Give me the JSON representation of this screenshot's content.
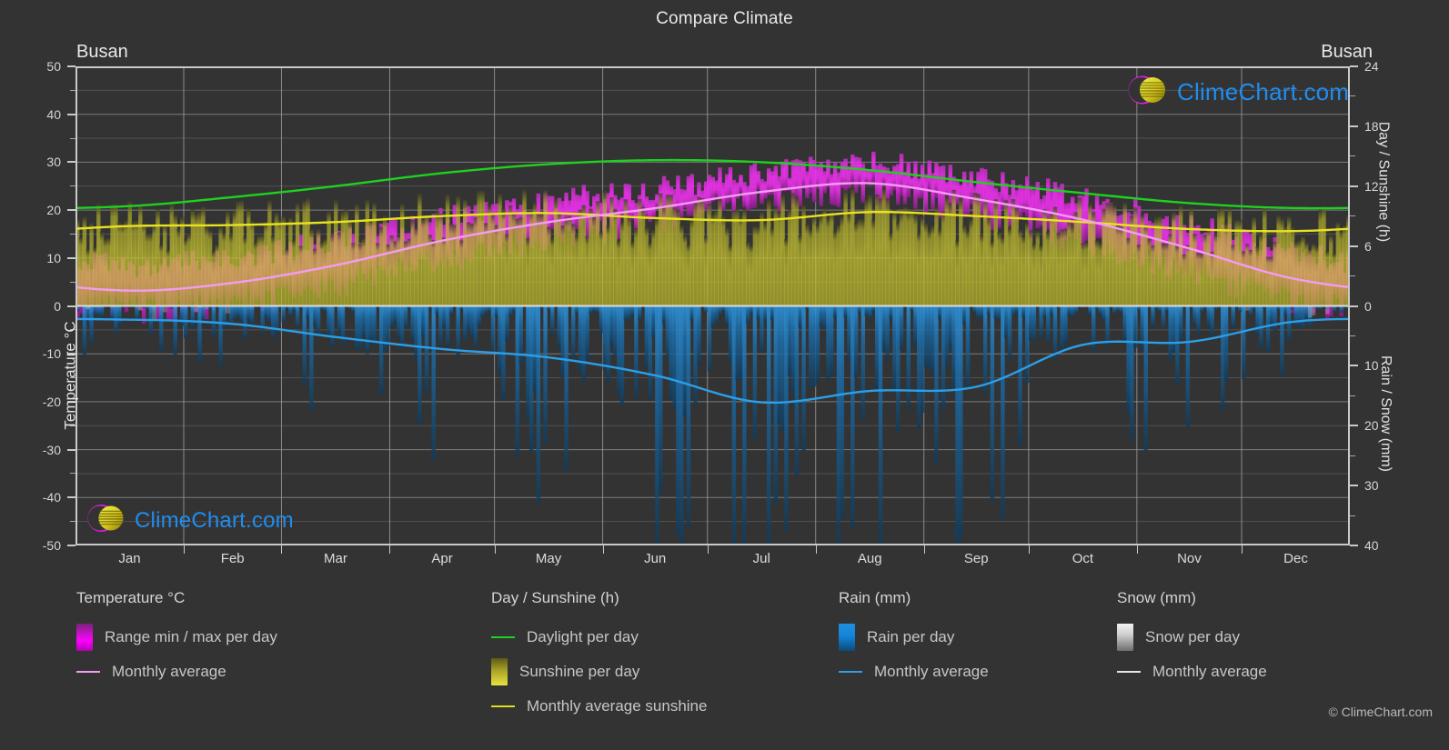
{
  "header": {
    "title": "Compare Climate",
    "city_left": "Busan",
    "city_right": "Busan"
  },
  "axes": {
    "left_title": "Temperature °C",
    "left_ticks": [
      "50",
      "40",
      "30",
      "20",
      "10",
      "0",
      "-10",
      "-20",
      "-30",
      "-40",
      "-50"
    ],
    "right_top_title": "Day / Sunshine (h)",
    "right_top_ticks": [
      "24",
      "18",
      "12",
      "6",
      "0"
    ],
    "right_bottom_title": "Rain / Snow (mm)",
    "right_bottom_ticks": [
      "0",
      "10",
      "20",
      "30",
      "40"
    ],
    "x_ticks": [
      "Jan",
      "Feb",
      "Mar",
      "Apr",
      "May",
      "Jun",
      "Jul",
      "Aug",
      "Sep",
      "Oct",
      "Nov",
      "Dec"
    ]
  },
  "legend": {
    "groups": [
      {
        "heading": "Temperature °C",
        "items": [
          {
            "label": "Range min / max per day",
            "marker": "box",
            "style": "sw-temp"
          },
          {
            "label": "Monthly average",
            "marker": "line",
            "color": "#f49cf4"
          }
        ]
      },
      {
        "heading": "Day / Sunshine (h)",
        "items": [
          {
            "label": "Daylight per day",
            "marker": "line",
            "color": "#1fd11f"
          },
          {
            "label": "Sunshine per day",
            "marker": "box",
            "style": "sw-sun"
          },
          {
            "label": "Monthly average sunshine",
            "marker": "line",
            "color": "#dede1e"
          }
        ]
      },
      {
        "heading": "Rain (mm)",
        "items": [
          {
            "label": "Rain per day",
            "marker": "box",
            "style": "sw-rain"
          },
          {
            "label": "Monthly average",
            "marker": "line",
            "color": "#2b9fe8"
          }
        ]
      },
      {
        "heading": "Snow (mm)",
        "items": [
          {
            "label": "Snow per day",
            "marker": "box",
            "style": "sw-snow"
          },
          {
            "label": "Monthly average",
            "marker": "line",
            "color": "#e6e6e6"
          }
        ]
      }
    ]
  },
  "watermark": {
    "text": "ClimeChart.com",
    "copyright": "© ClimeChart.com"
  },
  "colors": {
    "background": "#333333",
    "grid": "#8e8e8e",
    "temp_range": "#ff00ff",
    "temp_avg": "#f49cf4",
    "daylight": "#1fd11f",
    "sunshine": "#d8d62e",
    "sunshine_avg": "#e8e320",
    "rain": "#1f8fe0",
    "rain_avg": "#2b9fe8",
    "snow": "#dedede",
    "text": "#d6d6d6"
  },
  "chart_data": {
    "type": "area",
    "title": "Compare Climate",
    "subtitle": "Busan",
    "xlabel": "",
    "ylabel": "Temperature °C",
    "ylim": [
      -50,
      50
    ],
    "y2lim_top": [
      0,
      24
    ],
    "y2lim_bottom": [
      0,
      40
    ],
    "grid": true,
    "legend_position": "bottom",
    "categories": [
      "Jan",
      "Feb",
      "Mar",
      "Apr",
      "May",
      "Jun",
      "Jul",
      "Aug",
      "Sep",
      "Oct",
      "Nov",
      "Dec"
    ],
    "series": [
      {
        "name": "Monthly average temperature (°C)",
        "unit": "°C",
        "color": "#f49cf4",
        "values": [
          3.2,
          4.8,
          8.5,
          13.6,
          17.5,
          20.4,
          23.8,
          25.6,
          22.3,
          18.0,
          12.0,
          5.6
        ]
      },
      {
        "name": "Daily maximum temperature (°C)",
        "unit": "°C",
        "color": "#ff00ff",
        "values": [
          8.5,
          10.2,
          13.8,
          18.6,
          22.0,
          24.5,
          27.6,
          29.8,
          26.5,
          22.8,
          17.0,
          11.0
        ]
      },
      {
        "name": "Daily minimum temperature (°C)",
        "unit": "°C",
        "color": "#a000a0",
        "values": [
          -1.0,
          0.4,
          4.2,
          9.4,
          14.0,
          17.8,
          21.8,
          23.2,
          19.0,
          13.4,
          7.0,
          1.0
        ]
      },
      {
        "name": "Daylight per day (h)",
        "unit": "h",
        "color": "#1fd11f",
        "values": [
          10.0,
          10.9,
          12.0,
          13.3,
          14.2,
          14.6,
          14.4,
          13.6,
          12.4,
          11.3,
          10.3,
          9.8
        ]
      },
      {
        "name": "Monthly average sunshine (h)",
        "unit": "h",
        "color": "#e8e320",
        "values": [
          8.0,
          8.1,
          8.4,
          9.0,
          9.3,
          8.8,
          8.6,
          9.4,
          9.0,
          8.4,
          7.7,
          7.5
        ]
      },
      {
        "name": "Monthly average rain (mm)",
        "unit": "mm",
        "color": "#2b9fe8",
        "values": [
          2.3,
          3.0,
          5.2,
          7.2,
          8.6,
          11.6,
          16.1,
          14.2,
          13.5,
          6.5,
          6.0,
          2.6
        ]
      },
      {
        "name": "Monthly average snow (mm)",
        "unit": "mm",
        "color": "#e6e6e6",
        "values": [
          0.2,
          0.1,
          0.0,
          0.0,
          0.0,
          0.0,
          0.0,
          0.0,
          0.0,
          0.0,
          0.0,
          0.1
        ]
      }
    ]
  }
}
